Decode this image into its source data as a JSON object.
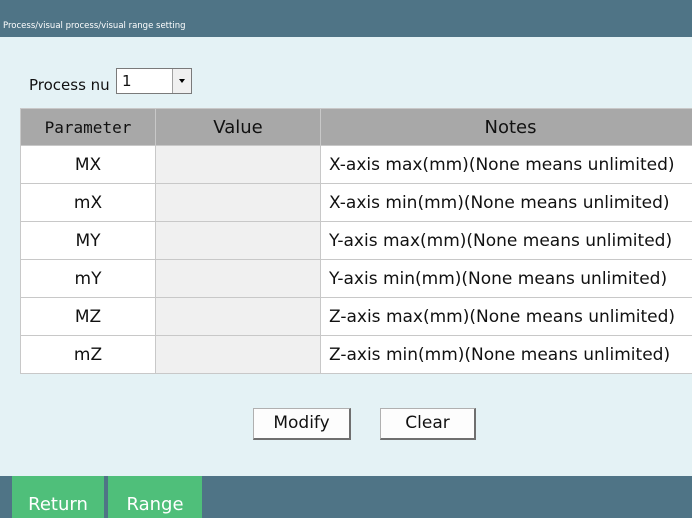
{
  "window": {
    "title": "Process/visual process/visual range setting"
  },
  "process": {
    "label": "Process nu",
    "selected": "1"
  },
  "table": {
    "headers": {
      "parameter": "Parameter",
      "value": "Value",
      "notes": "Notes"
    },
    "rows": [
      {
        "parameter": "MX",
        "value": "",
        "note": "X-axis max(mm)(None means unlimited)"
      },
      {
        "parameter": "mX",
        "value": "",
        "note": "X-axis min(mm)(None means unlimited)"
      },
      {
        "parameter": "MY",
        "value": "",
        "note": "Y-axis max(mm)(None means unlimited)"
      },
      {
        "parameter": "mY",
        "value": "",
        "note": "Y-axis min(mm)(None means unlimited)"
      },
      {
        "parameter": "MZ",
        "value": "",
        "note": "Z-axis max(mm)(None means unlimited)"
      },
      {
        "parameter": "mZ",
        "value": "",
        "note": "Z-axis min(mm)(None means unlimited)"
      }
    ]
  },
  "buttons": {
    "modify": "Modify",
    "clear": "Clear"
  },
  "footer": {
    "return_label": "Return",
    "range_label": "Range"
  },
  "colors": {
    "titlebar": "#4f7486",
    "background": "#e4f2f5",
    "tab": "#4fbf7a",
    "header": "#a8a8a8"
  }
}
